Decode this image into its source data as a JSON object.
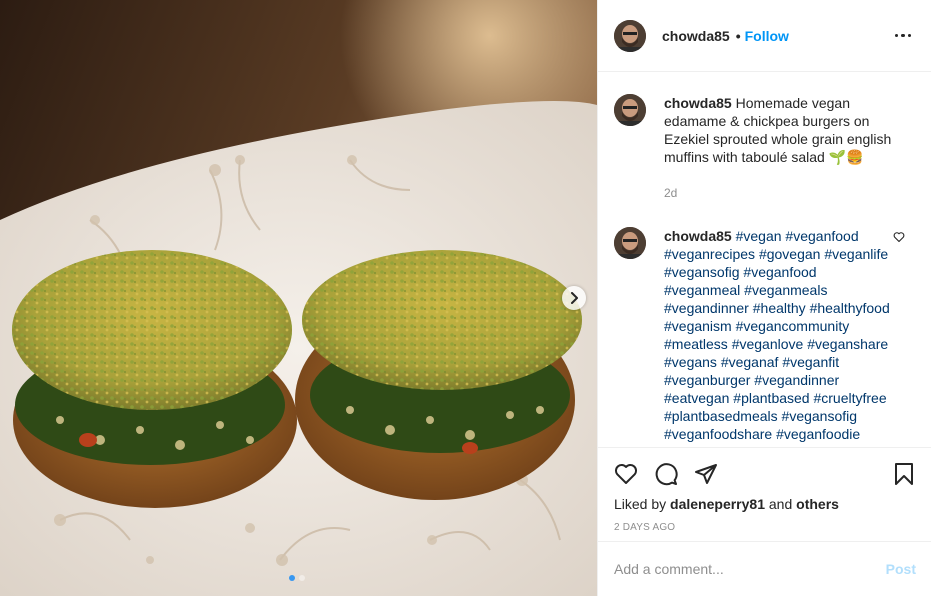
{
  "post": {
    "username": "chowda85",
    "follow_label": "Follow",
    "separator": "•"
  },
  "caption": {
    "username": "chowda85",
    "text": "Homemade vegan edamame & chickpea burgers on Ezekiel sprouted whole grain english muffins with taboulé salad 🌱🍔",
    "time": "2d"
  },
  "comment": {
    "username": "chowda85",
    "hashtags": [
      "#vegan",
      "#veganfood",
      "#veganrecipes",
      "#govegan",
      "#veganlife",
      "#vegansofig",
      "#veganfood",
      "#veganmeal",
      "#veganmeals",
      "#vegandinner",
      "#healthy",
      "#healthyfood",
      "#veganism",
      "#vegancommunity",
      "#meatless",
      "#veganlove",
      "#veganshare",
      "#vegans",
      "#veganaf",
      "#veganfit",
      "#veganburger",
      "#vegandinner",
      "#eatvegan",
      "#plantbased",
      "#crueltyfree",
      "#plantbasedmeals",
      "#vegansofig",
      "#veganfoodshare",
      "#veganfoodie"
    ]
  },
  "likes": {
    "prefix": "Liked by",
    "user": "daleneperry81",
    "joiner": "and",
    "others": "others"
  },
  "timestamp": "2 DAYS AGO",
  "add_comment": {
    "placeholder": "Add a comment...",
    "post_label": "Post"
  },
  "carousel": {
    "count": 2,
    "active_index": 0
  },
  "icons": [
    "more-icon",
    "heart-icon",
    "comment-icon",
    "share-icon",
    "save-icon",
    "chevron-right-icon"
  ],
  "colors": {
    "accent": "#0095f6",
    "link": "#00376b",
    "post_disabled": "#b2dffc",
    "muted": "#8e8e8e"
  }
}
